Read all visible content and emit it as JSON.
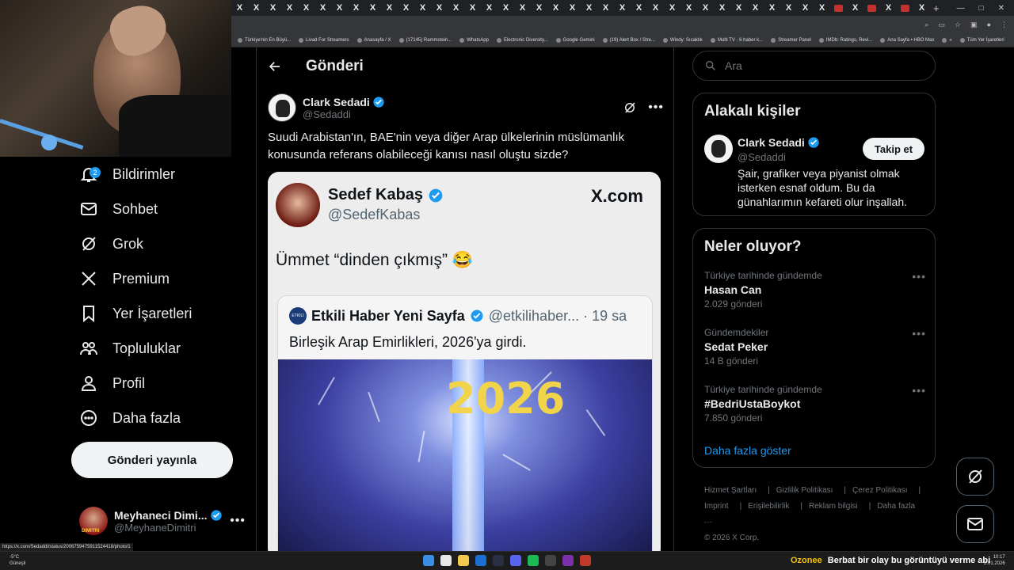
{
  "browser": {
    "tab_glyph": "X",
    "bookmarks": [
      "Türkiye'nin En Büyü...",
      "Livad For Streamers",
      "Anasayfa / X",
      "(17145) Rammstein...",
      "WhatsApp",
      "Electronic Diversity...",
      "Google Gemini",
      "(19) Alert Box / Stre...",
      "Windy: Sıcaklık",
      "Multi TV - 6 haber k...",
      "Streamer Panel",
      "IMDb: Ratings, Revi...",
      "Ana Sayfa • HBO Max",
      "»",
      "Tüm Yer İşaretleri"
    ]
  },
  "nav": {
    "notifications_badge": "2",
    "items": [
      {
        "label": "Bildirimler",
        "icon": "bell-icon"
      },
      {
        "label": "Sohbet",
        "icon": "envelope-icon"
      },
      {
        "label": "Grok",
        "icon": "grok-icon"
      },
      {
        "label": "Premium",
        "icon": "x-logo-icon"
      },
      {
        "label": "Yer İşaretleri",
        "icon": "bookmark-icon"
      },
      {
        "label": "Topluluklar",
        "icon": "people-icon"
      },
      {
        "label": "Profil",
        "icon": "person-icon"
      },
      {
        "label": "Daha fazla",
        "icon": "more-circle-icon"
      }
    ],
    "post_button": "Gönderi yayınla",
    "account": {
      "name": "Meyhaneci Dimi...",
      "handle": "@MeyhaneDimitri",
      "avatar_text": "DIMITRI"
    }
  },
  "main": {
    "title": "Gönderi",
    "tweet": {
      "author": "Clark Sedadi",
      "handle": "@Sedaddi",
      "text": "Suudi Arabistan'ın, BAE'nin veya diğer Arap ülkelerinin müslümanlık konusunda referans olabileceği kanısı nasıl oluştu sizde?"
    },
    "card": {
      "name": "Sedef Kabaş",
      "handle": "@SedefKabas",
      "site": "X.com",
      "text": "Ümmet “dinden çıkmış” 😂",
      "quote": {
        "avatar_text": "ETKİLİ",
        "name": "Etkili Haber Yeni Sayfa",
        "meta": "@etkilihaber... · 19 sa",
        "text": "Birleşik Arap Emirlikleri, 2026'ya girdi.",
        "image_text": "2026"
      }
    }
  },
  "right": {
    "search_placeholder": "Ara",
    "related": {
      "title": "Alakalı kişiler",
      "name": "Clark Sedadi",
      "handle": "@Sedaddi",
      "follow": "Takip et",
      "bio": "Şair, grafiker veya piyanist olmak isterken esnaf oldum. Bu da günahlarımın kefareti olur inşallah."
    },
    "trends": {
      "title": "Neler oluyor?",
      "items": [
        {
          "context": "Türkiye tarihinde gündemde",
          "name": "Hasan Can",
          "count": "2.029 gönderi"
        },
        {
          "context": "Gündemdekiler",
          "name": "Sedat Peker",
          "count": "14 B gönderi"
        },
        {
          "context": "Türkiye tarihinde gündemde",
          "name": "#BedriUstaBoykot",
          "count": "7.850 gönderi"
        }
      ],
      "show_more": "Daha fazla göster"
    },
    "footer": [
      "Hizmet Şartları",
      "|",
      "Gizlilik Politikası",
      "|",
      "Çerez Politikası",
      "|",
      "Imprint",
      "|",
      "Erişilebilirlik",
      "|",
      "Reklam bilgisi",
      "|",
      "Daha fazla ···",
      "© 2026 X Corp."
    ]
  },
  "status_url": "https://x.com/Sedaddi/status/2006759475911524418/photo/1",
  "taskbar": {
    "weather_temp": "-5°C",
    "weather_desc": "Güneşli",
    "ticker_source": "Ozonee",
    "ticker_text": "Berbat bir olay bu görüntüyü verme abi",
    "time": "10:17",
    "date": "2.01.2026"
  },
  "colors": {
    "accent": "#1d9bf0",
    "background": "#000000",
    "border": "#2f3336",
    "muted": "#71767b"
  }
}
